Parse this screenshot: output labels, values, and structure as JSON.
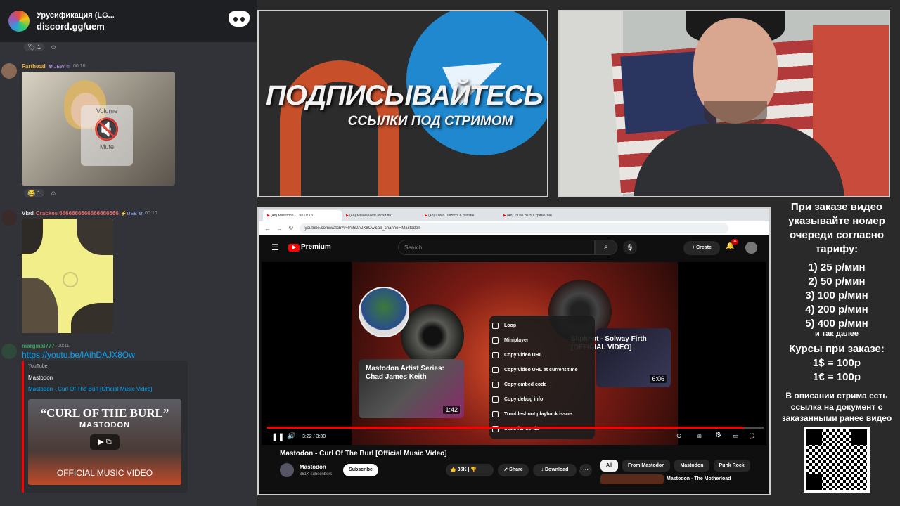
{
  "discord": {
    "server_name": "Урусификация (LG...",
    "invite": "discord.gg/uem",
    "reaction1": "1",
    "msg1": {
      "user": "Farthead",
      "tags": "☢ JEW ♔",
      "time": "00:10",
      "volume_label": "Volume",
      "mute_label": "Mute",
      "reaction": "1"
    },
    "msg2": {
      "user": "Vlad",
      "user_suffix": "Crackes 6666666666666666666",
      "tags": "⚡UEB ⚙",
      "time": "00:10"
    },
    "msg3": {
      "user": "marginal777",
      "time": "00:11",
      "link": "https://youtu.be/lAihDAJX8Ow",
      "embed": {
        "provider": "YouTube",
        "author": "Mastodon",
        "title": "Mastodon - Curl Of The Burl [Official Music Video]",
        "thumb_title": "“CURL OF THE BURL”",
        "thumb_band": "MASTODON",
        "thumb_caption": "OFFICIAL MUSIC VIDEO"
      }
    }
  },
  "promo": {
    "line1": "ПОДПИСЫВАЙТЕСЬ",
    "line2": "ССЫЛКИ ПОД СТРИМОМ"
  },
  "browser": {
    "tabs": [
      "(48) Mastodon - Curl Of Th",
      "(48) Мошенники эпохи по...",
      "(48) Chico Dattochi & passhe",
      "(48) 19.08.2025 Стрим Chat"
    ],
    "url": "youtube.com/watch?v=lAihDAJX8Ow&ab_channel=Mastodon",
    "yt": {
      "brand": "Premium",
      "search_placeholder": "Search",
      "create_label": "Create",
      "notif_count": "9+",
      "context_menu": [
        "Loop",
        "Miniplayer",
        "Copy video URL",
        "Copy video URL at current time",
        "Copy embed code",
        "Copy debug info",
        "Troubleshoot playback issue",
        "Stats for nerds"
      ],
      "endcard_left": {
        "title": "Mastodon Artist Series: Chad James Keith",
        "duration": "1:42"
      },
      "endcard_right": {
        "title": "Slipknot - Solway Firth [OFFICIAL VIDEO]",
        "duration": "6:06"
      },
      "time": "3:22 / 3:30",
      "progress": 0.96,
      "video_title": "Mastodon - Curl Of The Burl [Official Music Video]",
      "channel": "Mastodon",
      "subscribers": "361K subscribers",
      "subscribe_label": "Subscribe",
      "likes": "35K",
      "share_label": "Share",
      "download_label": "Download",
      "chips": [
        "All",
        "From Mastodon",
        "Mastodon",
        "Punk Rock"
      ],
      "rec_title": "Mastodon - The Motherload"
    }
  },
  "sidetext": {
    "intro": "При заказе видео указывайте номер очереди согласно тарифу:",
    "tariffs": [
      "1) 25 р/мин",
      "2) 50 р/мин",
      "3) 100 р/мин",
      "4) 200 р/мин",
      "5) 400 р/мин"
    ],
    "etc": "и так далее",
    "courses_title": "Курсы при заказе:",
    "courses": [
      "1$ = 100р",
      "1€ = 100р"
    ],
    "note": "В описании стрима есть ссылка на документ с заказанными ранее видео"
  },
  "colors": {
    "youtube_red": "#ff0000",
    "discord_bg": "#313338",
    "link": "#00a8fc"
  }
}
